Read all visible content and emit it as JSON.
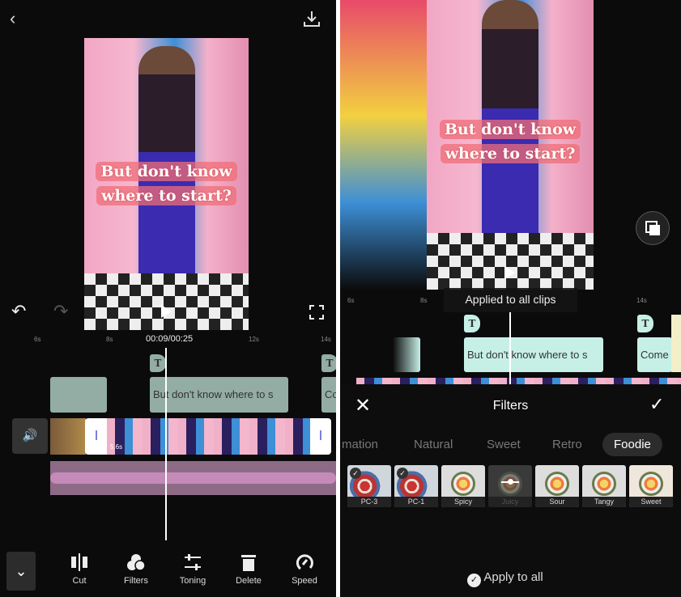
{
  "left": {
    "timecode": "00:09/00:25",
    "ruler": [
      "6s",
      "8s",
      "12s",
      "14s"
    ],
    "video_caption": [
      "But don't know",
      "where to start?"
    ],
    "text_clips": [
      "But don't know  where to s",
      "Co"
    ],
    "clip_duration": "5.6s",
    "toolbar": [
      {
        "label": "Cut",
        "icon": "cut-icon"
      },
      {
        "label": "Filters",
        "icon": "filters-icon"
      },
      {
        "label": "Toning",
        "icon": "toning-icon"
      },
      {
        "label": "Delete",
        "icon": "delete-icon"
      },
      {
        "label": "Speed",
        "icon": "speed-icon"
      }
    ]
  },
  "right": {
    "video_caption": [
      "But don't know",
      "where to start?"
    ],
    "ruler": [
      "6s",
      "8s",
      "14s"
    ],
    "toast": "Applied to all clips",
    "text_clips": [
      "But don't know  where to s",
      "Come"
    ],
    "filters": {
      "title": "Filters",
      "tabs": [
        "mation",
        "Natural",
        "Sweet",
        "Retro",
        "Foodie"
      ],
      "selected_tab": "Foodie",
      "items": [
        {
          "label": "PC-3",
          "checked": true
        },
        {
          "label": "PC-1",
          "checked": true
        },
        {
          "label": "Spicy"
        },
        {
          "label": "Juicy",
          "selected": true
        },
        {
          "label": "Sour"
        },
        {
          "label": "Tangy"
        },
        {
          "label": "Sweet"
        }
      ],
      "apply_all": "Apply to all"
    }
  }
}
